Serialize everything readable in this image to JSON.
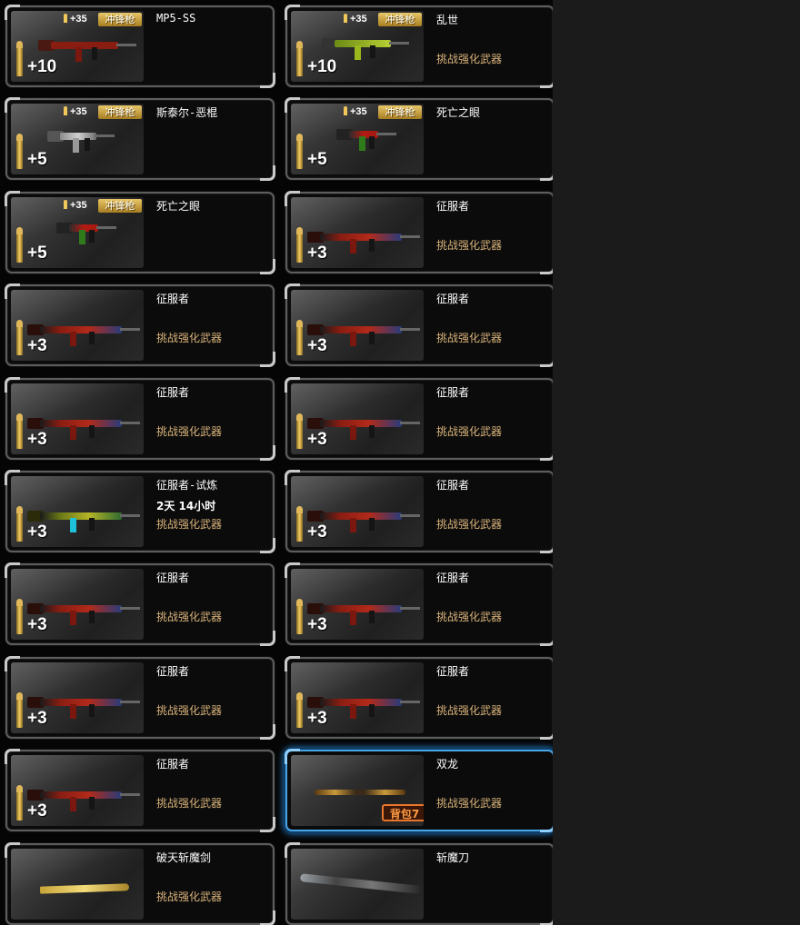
{
  "items": [
    {
      "name": "MP5-SS",
      "level": "+10",
      "tag": "",
      "ammo": "+35",
      "badge": "冲锋枪",
      "gun": "smg-red"
    },
    {
      "name": "乱世",
      "level": "+10",
      "tag": "挑战强化武器",
      "ammo": "+35",
      "badge": "冲锋枪",
      "gun": "p90-green"
    },
    {
      "name": "斯泰尔-恶棍",
      "level": "+5",
      "tag": "",
      "ammo": "+35",
      "badge": "冲锋枪",
      "gun": "smg-gray"
    },
    {
      "name": "死亡之眼",
      "level": "+5",
      "tag": "",
      "ammo": "+35",
      "badge": "冲锋枪",
      "gun": "smg-redgreen"
    },
    {
      "name": "死亡之眼",
      "level": "+5",
      "tag": "",
      "ammo": "+35",
      "badge": "冲锋枪",
      "gun": "smg-redgreen"
    },
    {
      "name": "征服者",
      "level": "+3",
      "tag": "挑战强化武器",
      "gun": "rifle-red"
    },
    {
      "name": "征服者",
      "level": "+3",
      "tag": "挑战强化武器",
      "gun": "rifle-red"
    },
    {
      "name": "征服者",
      "level": "+3",
      "tag": "挑战强化武器",
      "gun": "rifle-red"
    },
    {
      "name": "征服者",
      "level": "+3",
      "tag": "挑战强化武器",
      "gun": "rifle-red"
    },
    {
      "name": "征服者",
      "level": "+3",
      "tag": "挑战强化武器",
      "gun": "rifle-red"
    },
    {
      "name": "征服者-试炼",
      "level": "+3",
      "tag": "挑战强化武器",
      "timer": "2天  14小时",
      "gun": "rifle-green"
    },
    {
      "name": "征服者",
      "level": "+3",
      "tag": "挑战强化武器",
      "gun": "rifle-red"
    },
    {
      "name": "征服者",
      "level": "+3",
      "tag": "挑战强化武器",
      "gun": "rifle-red"
    },
    {
      "name": "征服者",
      "level": "+3",
      "tag": "挑战强化武器",
      "gun": "rifle-red"
    },
    {
      "name": "征服者",
      "level": "+3",
      "tag": "挑战强化武器",
      "gun": "rifle-red"
    },
    {
      "name": "征服者",
      "level": "+3",
      "tag": "挑战强化武器",
      "gun": "rifle-red"
    },
    {
      "name": "征服者",
      "level": "+3",
      "tag": "挑战强化武器",
      "gun": "rifle-red"
    },
    {
      "name": "双龙",
      "level": "",
      "tag": "挑战强化武器",
      "bag": "背包7",
      "selected": true,
      "gun": "dual-blade"
    },
    {
      "name": "破天斩魔剑",
      "level": "",
      "tag": "挑战强化武器",
      "gun": "gold-sword"
    },
    {
      "name": "斩魔刀",
      "level": "",
      "tag": "",
      "gun": "dark-blade"
    }
  ],
  "colors": {
    "gold_text": "#d8b27a",
    "selected_border": "#49a6e6",
    "bag_badge": "#e8762c"
  }
}
